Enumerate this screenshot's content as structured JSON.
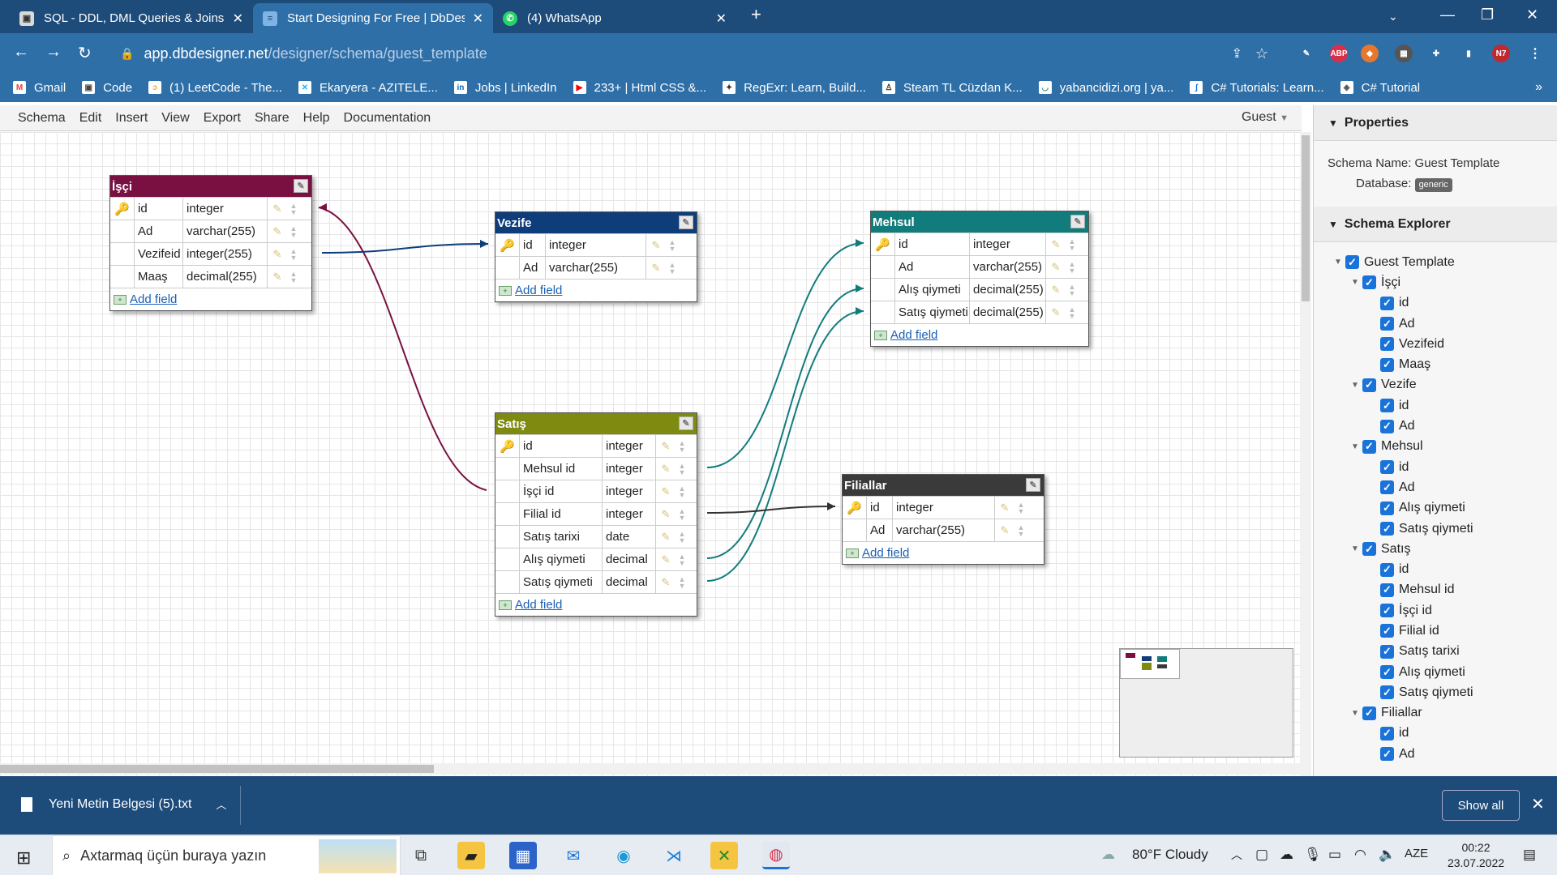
{
  "tabs": [
    {
      "title": "SQL - DDL, DML Queries & Joins",
      "active": false
    },
    {
      "title": "Start Designing For Free | DbDesi",
      "active": true
    },
    {
      "title": "(4) WhatsApp",
      "active": false
    }
  ],
  "new_tab_label": "+",
  "address": {
    "url_host": "app.dbdesigner.net",
    "url_path": "/designer/schema/guest_template"
  },
  "extensions": [
    {
      "label": "ABP",
      "color": "#d9304a"
    },
    {
      "label": "N7",
      "color": "#c0282f"
    }
  ],
  "bookmarks": [
    {
      "label": "Gmail",
      "icon": "gmail-icon",
      "color": "#ea4335",
      "glyph": "M"
    },
    {
      "label": "Code",
      "icon": "code-icon",
      "color": "#444",
      "glyph": "▣"
    },
    {
      "label": "(1) LeetCode - The...",
      "icon": "leetcode-icon",
      "color": "#f0a830",
      "glyph": "ↄ"
    },
    {
      "label": "Ekaryera - AZITELE...",
      "icon": "ekaryera-icon",
      "color": "#1fb6ff",
      "glyph": "✕"
    },
    {
      "label": "Jobs | LinkedIn",
      "icon": "linkedin-icon",
      "color": "#0a66c2",
      "glyph": "in"
    },
    {
      "label": "233+ | Html CSS &...",
      "icon": "youtube-icon",
      "color": "#ff0000",
      "glyph": "▶"
    },
    {
      "label": "RegExr: Learn, Build...",
      "icon": "regexr-icon",
      "color": "#333",
      "glyph": "✦"
    },
    {
      "label": "Steam TL Cüzdan K...",
      "icon": "steam-icon",
      "color": "#333",
      "glyph": "♙"
    },
    {
      "label": "yabancidizi.org | ya...",
      "icon": "yabancidizi-icon",
      "color": "#2a8a8a",
      "glyph": "◡"
    },
    {
      "label": "C# Tutorials: Learn...",
      "icon": "csharp-tutorials-icon",
      "color": "#1a73d9",
      "glyph": "ʃ"
    },
    {
      "label": "C# Tutorial",
      "icon": "csharp-tutorial-icon",
      "color": "#555",
      "glyph": "◈"
    }
  ],
  "menu": [
    "Schema",
    "Edit",
    "Insert",
    "View",
    "Export",
    "Share",
    "Help",
    "Documentation"
  ],
  "user_menu": "Guest",
  "tables": [
    {
      "id": "isci",
      "name": "İşçi",
      "color": "#7a1042",
      "fields": [
        {
          "name": "id",
          "type": "integer",
          "pk": true
        },
        {
          "name": "Ad",
          "type": "varchar(255)"
        },
        {
          "name": "Vezifeid",
          "type": "integer(255)"
        },
        {
          "name": "Maaş",
          "type": "decimal(255)"
        }
      ]
    },
    {
      "id": "vezife",
      "name": "Vezife",
      "color": "#0e3d7a",
      "fields": [
        {
          "name": "id",
          "type": "integer",
          "pk": true
        },
        {
          "name": "Ad",
          "type": "varchar(255)"
        }
      ]
    },
    {
      "id": "mehsul",
      "name": "Mehsul",
      "color": "#127c7c",
      "fields": [
        {
          "name": "id",
          "type": "integer",
          "pk": true
        },
        {
          "name": "Ad",
          "type": "varchar(255)"
        },
        {
          "name": "Alış qiymeti",
          "type": "decimal(255)"
        },
        {
          "name": "Satış qiymeti",
          "type": "decimal(255)"
        }
      ]
    },
    {
      "id": "satis",
      "name": "Satış",
      "color": "#7f8a10",
      "fields": [
        {
          "name": "id",
          "type": "integer",
          "pk": true
        },
        {
          "name": "Mehsul id",
          "type": "integer"
        },
        {
          "name": "İşçi id",
          "type": "integer"
        },
        {
          "name": "Filial id",
          "type": "integer"
        },
        {
          "name": "Satış tarixi",
          "type": "date"
        },
        {
          "name": "Alış qiymeti",
          "type": "decimal"
        },
        {
          "name": "Satış qiymeti",
          "type": "decimal"
        }
      ]
    },
    {
      "id": "filiallar",
      "name": "Filiallar",
      "color": "#3a3a3a",
      "fields": [
        {
          "name": "id",
          "type": "integer",
          "pk": true
        },
        {
          "name": "Ad",
          "type": "varchar(255)"
        }
      ]
    }
  ],
  "add_field_label": "Add field",
  "relations": [
    {
      "from": "satis.İşçi id",
      "to": "isci.id",
      "color": "#7a1042"
    },
    {
      "from": "isci.Vezifeid",
      "to": "vezife.id",
      "color": "#0e3d7a"
    },
    {
      "from": "satis.Mehsul id",
      "to": "mehsul.id",
      "color": "#127c7c"
    },
    {
      "from": "satis.Alış qiymeti",
      "to": "mehsul.Alış qiymeti",
      "color": "#127c7c"
    },
    {
      "from": "satis.Satış qiymeti",
      "to": "mehsul.Satış qiymeti",
      "color": "#127c7c"
    },
    {
      "from": "satis.Filial id",
      "to": "filiallar.id",
      "color": "#333333"
    }
  ],
  "properties": {
    "header": "Properties",
    "schema_label": "Schema Name:",
    "schema_name": "Guest Template",
    "database_label": "Database:",
    "database": "generic"
  },
  "explorer": {
    "header": "Schema Explorer",
    "root": "Guest Template",
    "tables": [
      {
        "name": "İşçi",
        "fields": [
          "id",
          "Ad",
          "Vezifeid",
          "Maaş"
        ]
      },
      {
        "name": "Vezife",
        "fields": [
          "id",
          "Ad"
        ]
      },
      {
        "name": "Mehsul",
        "fields": [
          "id",
          "Ad",
          "Alış qiymeti",
          "Satış qiymeti"
        ]
      },
      {
        "name": "Satış",
        "fields": [
          "id",
          "Mehsul id",
          "İşçi id",
          "Filial id",
          "Satış tarixi",
          "Alış qiymeti",
          "Satış qiymeti"
        ]
      },
      {
        "name": "Filiallar",
        "fields": [
          "id",
          "Ad"
        ]
      }
    ]
  },
  "download": {
    "file": "Yeni Metin Belgesi (5).txt",
    "show_all": "Show all"
  },
  "taskbar": {
    "search_placeholder": "Axtarmaq üçün buraya yazın",
    "weather": "80°F  Cloudy",
    "lang": "AZE",
    "time": "00:22",
    "date": "23.07.2022"
  }
}
